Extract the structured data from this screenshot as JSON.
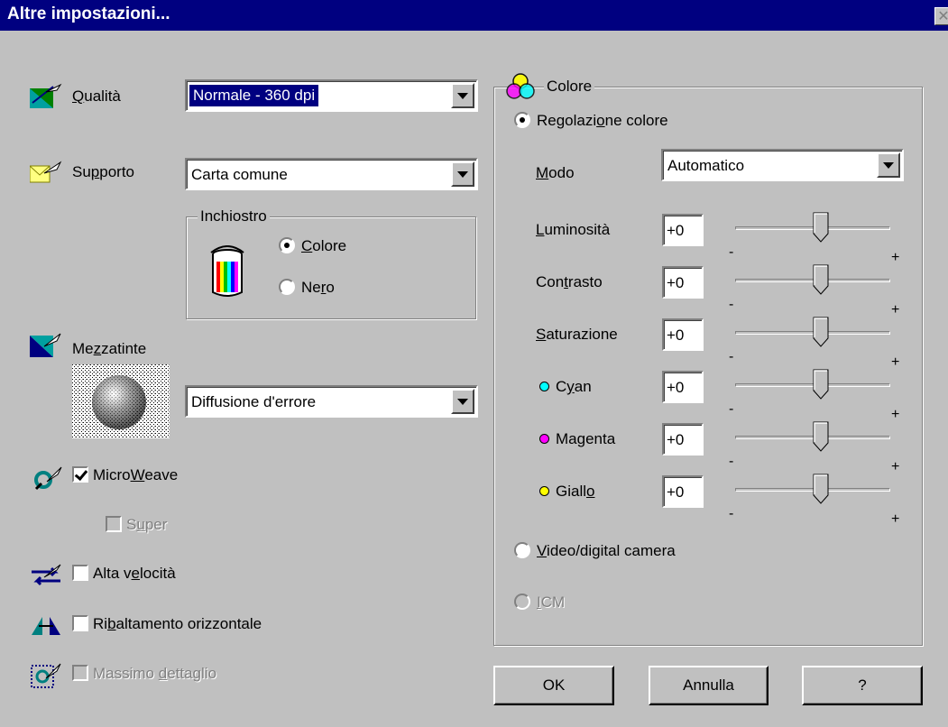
{
  "window": {
    "title": "Altre impostazioni...",
    "close_glyph": "✕"
  },
  "left": {
    "quality": {
      "label_u": "Q",
      "label_rest": "ualità",
      "value": "Normale - 360 dpi"
    },
    "media": {
      "label_a": "Su",
      "label_u": "p",
      "label_b": "porto",
      "value": "Carta comune"
    },
    "ink": {
      "title": "Inchiostro",
      "color_u": "C",
      "color_rest": "olore",
      "black_a": "Ne",
      "black_u": "r",
      "black_b": "o"
    },
    "halftone": {
      "label_a": "Me",
      "label_u": "z",
      "label_b": "zatinte",
      "value": "Diffusione d'errore"
    },
    "microweave": {
      "label_a": "Micro",
      "label_u": "W",
      "label_b": "eave",
      "checked": true
    },
    "super": {
      "label_a": "S",
      "label_u": "u",
      "label_b": "per",
      "checked": false
    },
    "high_speed": {
      "label_a": "Alta v",
      "label_u": "e",
      "label_b": "locità",
      "checked": false
    },
    "flip": {
      "label_a": "Ri",
      "label_u": "b",
      "label_b": "altamento orizzontale",
      "checked": false
    },
    "max_detail": {
      "label_a": "Massimo ",
      "label_u": "d",
      "label_b": "ettaglio",
      "checked": false
    }
  },
  "color": {
    "title": "Colore",
    "adjust": {
      "label_a": "Regolazi",
      "label_u": "o",
      "label_b": "ne colore",
      "selected": true
    },
    "mode": {
      "label_u": "M",
      "label_rest": "odo",
      "value": "Automatico"
    },
    "sliders": [
      {
        "label_u": "L",
        "label_rest": "uminosità",
        "value": "+0",
        "level": 0.5
      },
      {
        "label_a": "Con",
        "label_u": "t",
        "label_b": "rasto",
        "value": "+0",
        "level": 0.5
      },
      {
        "label_u": "S",
        "label_rest": "aturazione",
        "value": "+0",
        "level": 0.5
      },
      {
        "label_a": "C",
        "label_u": "y",
        "label_b": "an",
        "value": "+0",
        "level": 0.5,
        "dot_color": "#00ffff"
      },
      {
        "label_a": "Magenta",
        "label_u": "",
        "label_b": "",
        "value": "+0",
        "level": 0.5,
        "dot_color": "#ff00ff"
      },
      {
        "label_a": "Giall",
        "label_u": "o",
        "label_b": "",
        "value": "+0",
        "level": 0.5,
        "dot_color": "#ffff00"
      }
    ],
    "tick_minus": "-",
    "tick_plus": "+",
    "video": {
      "label_u": "V",
      "label_rest": "ideo/digital camera",
      "selected": false
    },
    "icm": {
      "label_u": "I",
      "label_rest": "CM",
      "selected": false
    }
  },
  "buttons": {
    "ok": "OK",
    "cancel": "Annulla",
    "help": "?"
  }
}
